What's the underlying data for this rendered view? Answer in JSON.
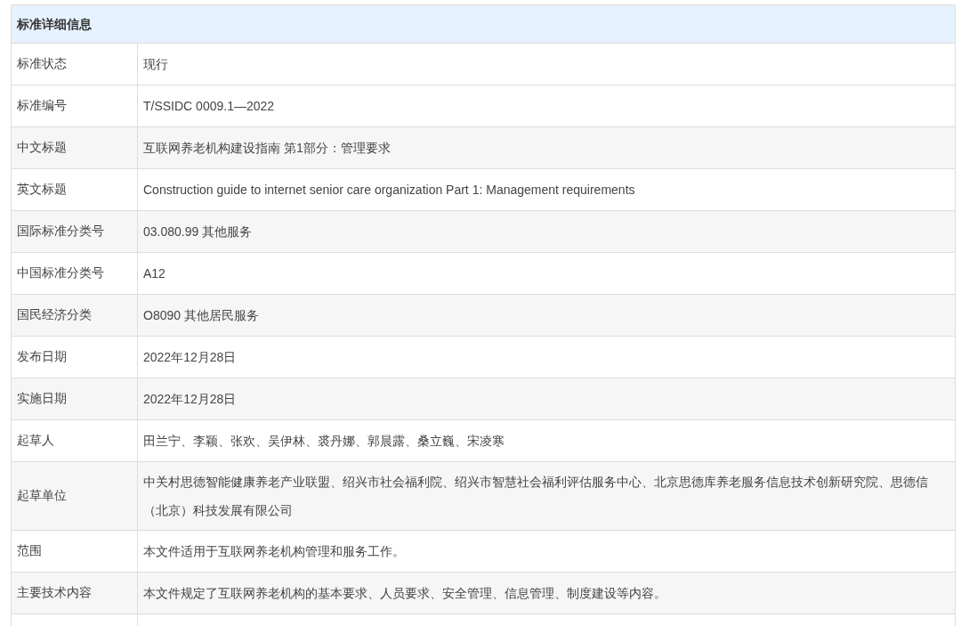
{
  "table": {
    "title": "标准详细信息",
    "rows": [
      {
        "label": "标准状态",
        "value": "现行"
      },
      {
        "label": "标准编号",
        "value": "T/SSIDC 0009.1—2022"
      },
      {
        "label": "中文标题",
        "value": "互联网养老机构建设指南 第1部分：管理要求"
      },
      {
        "label": "英文标题",
        "value": "Construction guide to internet senior care organization Part 1: Management requirements"
      },
      {
        "label": "国际标准分类号",
        "value": "03.080.99 其他服务"
      },
      {
        "label": "中国标准分类号",
        "value": "A12"
      },
      {
        "label": "国民经济分类",
        "value": "O8090 其他居民服务"
      },
      {
        "label": "发布日期",
        "value": "2022年12月28日"
      },
      {
        "label": "实施日期",
        "value": "2022年12月28日"
      },
      {
        "label": "起草人",
        "value": "田兰宁、李颖、张欢、吴伊林、裘丹娜、郭晨露、桑立巍、宋凌寒"
      },
      {
        "label": "起草单位",
        "value": "中关村思德智能健康养老产业联盟、绍兴市社会福利院、绍兴市智慧社会福利评估服务中心、北京思德库养老服务信息技术创新研究院、思德信（北京）科技发展有限公司"
      },
      {
        "label": "范围",
        "value": "本文件适用于互联网养老机构管理和服务工作。"
      },
      {
        "label": "主要技术内容",
        "value": "本文件规定了互联网养老机构的基本要求、人员要求、安全管理、信息管理、制度建设等内容。"
      }
    ]
  }
}
